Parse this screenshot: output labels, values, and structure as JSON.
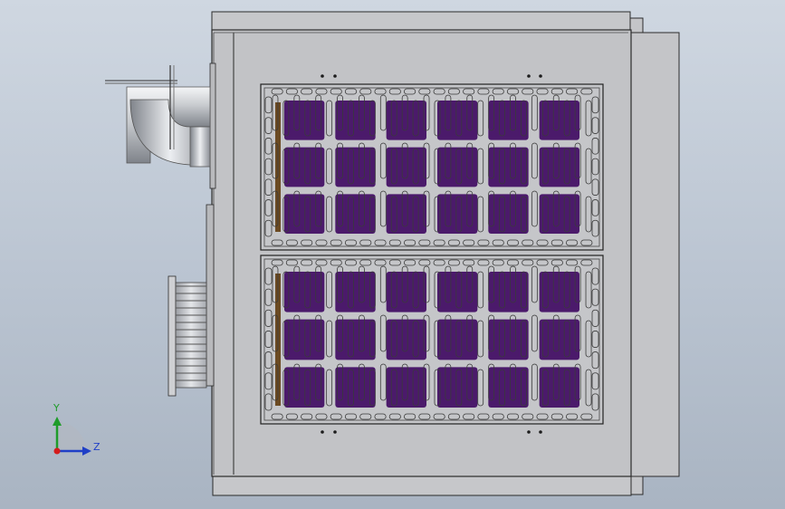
{
  "viewport": {
    "background_top": "#cfd7e1",
    "background_bottom": "#a9b4c2"
  },
  "colors": {
    "body_fill": "#c2c3c6",
    "body_stroke": "#2b2b2b",
    "panel_fill": "#c8c9cb",
    "grille_fill": "#c5c6c9",
    "slot_fill": "#bfc0c3",
    "coil_purple": "#4b1a6b",
    "coil_brown": "#6b4a22",
    "pipe_light": "#eef0f2",
    "pipe_dark": "#8d9096"
  },
  "icons": {
    "triad": "coordinate-triad-icon"
  },
  "triad": {
    "y_label": "Y",
    "z_label": "Z",
    "y_color": "#1e9c2a",
    "z_color": "#1f3fc7",
    "x_color": "#d41c1c"
  }
}
